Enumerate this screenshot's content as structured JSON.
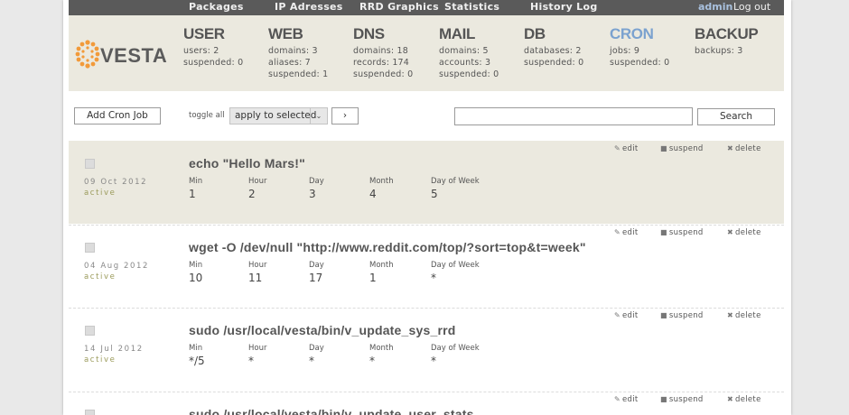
{
  "nav": {
    "items": [
      "Packages",
      "IP Adresses",
      "RRD Graphics",
      "Statistics",
      "History Log"
    ],
    "user": "admin",
    "logout": "Log out"
  },
  "logo": {
    "text": "VESTA"
  },
  "stats": [
    {
      "title": "USER",
      "lines": [
        "users: 2",
        "suspended: 0"
      ]
    },
    {
      "title": "WEB",
      "lines": [
        "domains: 3",
        "aliases: 7",
        "suspended: 1"
      ]
    },
    {
      "title": "DNS",
      "lines": [
        "domains: 18",
        "records: 174",
        "suspended: 0"
      ]
    },
    {
      "title": "MAIL",
      "lines": [
        "domains: 5",
        "accounts: 3",
        "suspended: 0"
      ]
    },
    {
      "title": "DB",
      "lines": [
        "databases: 2",
        "suspended: 0"
      ]
    },
    {
      "title": "CRON",
      "lines": [
        "jobs: 9",
        "suspended: 0"
      ]
    },
    {
      "title": "BACKUP",
      "lines": [
        "backups: 3"
      ]
    }
  ],
  "toolbar": {
    "add_button": "Add Cron Job",
    "toggle_label": "toggle all",
    "select_value": "apply to selected",
    "apply_button": "›",
    "search_value": "",
    "search_button": "Search"
  },
  "action_labels": {
    "edit": "edit",
    "suspend": "suspend",
    "delete": "delete"
  },
  "field_labels": [
    "Min",
    "Hour",
    "Day",
    "Month",
    "Day of Week"
  ],
  "jobs": [
    {
      "date": "09 Oct 2012",
      "status": "active",
      "command": "echo \"Hello Mars!\"",
      "values": [
        "1",
        "2",
        "3",
        "4",
        "5"
      ]
    },
    {
      "date": "04 Aug 2012",
      "status": "active",
      "command": "wget -O /dev/null \"http://www.reddit.com/top/?sort=top&t=week\"",
      "values": [
        "10",
        "11",
        "17",
        "1",
        "*"
      ]
    },
    {
      "date": "14 Jul 2012",
      "status": "active",
      "command": "sudo /usr/local/vesta/bin/v_update_sys_rrd",
      "values": [
        "*/5",
        "*",
        "*",
        "*",
        "*"
      ]
    },
    {
      "date": "",
      "status": "",
      "command": "sudo /usr/local/vesta/bin/v_update_user_stats",
      "values": [
        "",
        "",
        "",
        "",
        ""
      ]
    }
  ],
  "colors": {
    "accent": "#7ba2cf",
    "topbar": "#5a5a5a",
    "header_bg": "#ebe9df",
    "logo_orange": "#f29a3a"
  }
}
